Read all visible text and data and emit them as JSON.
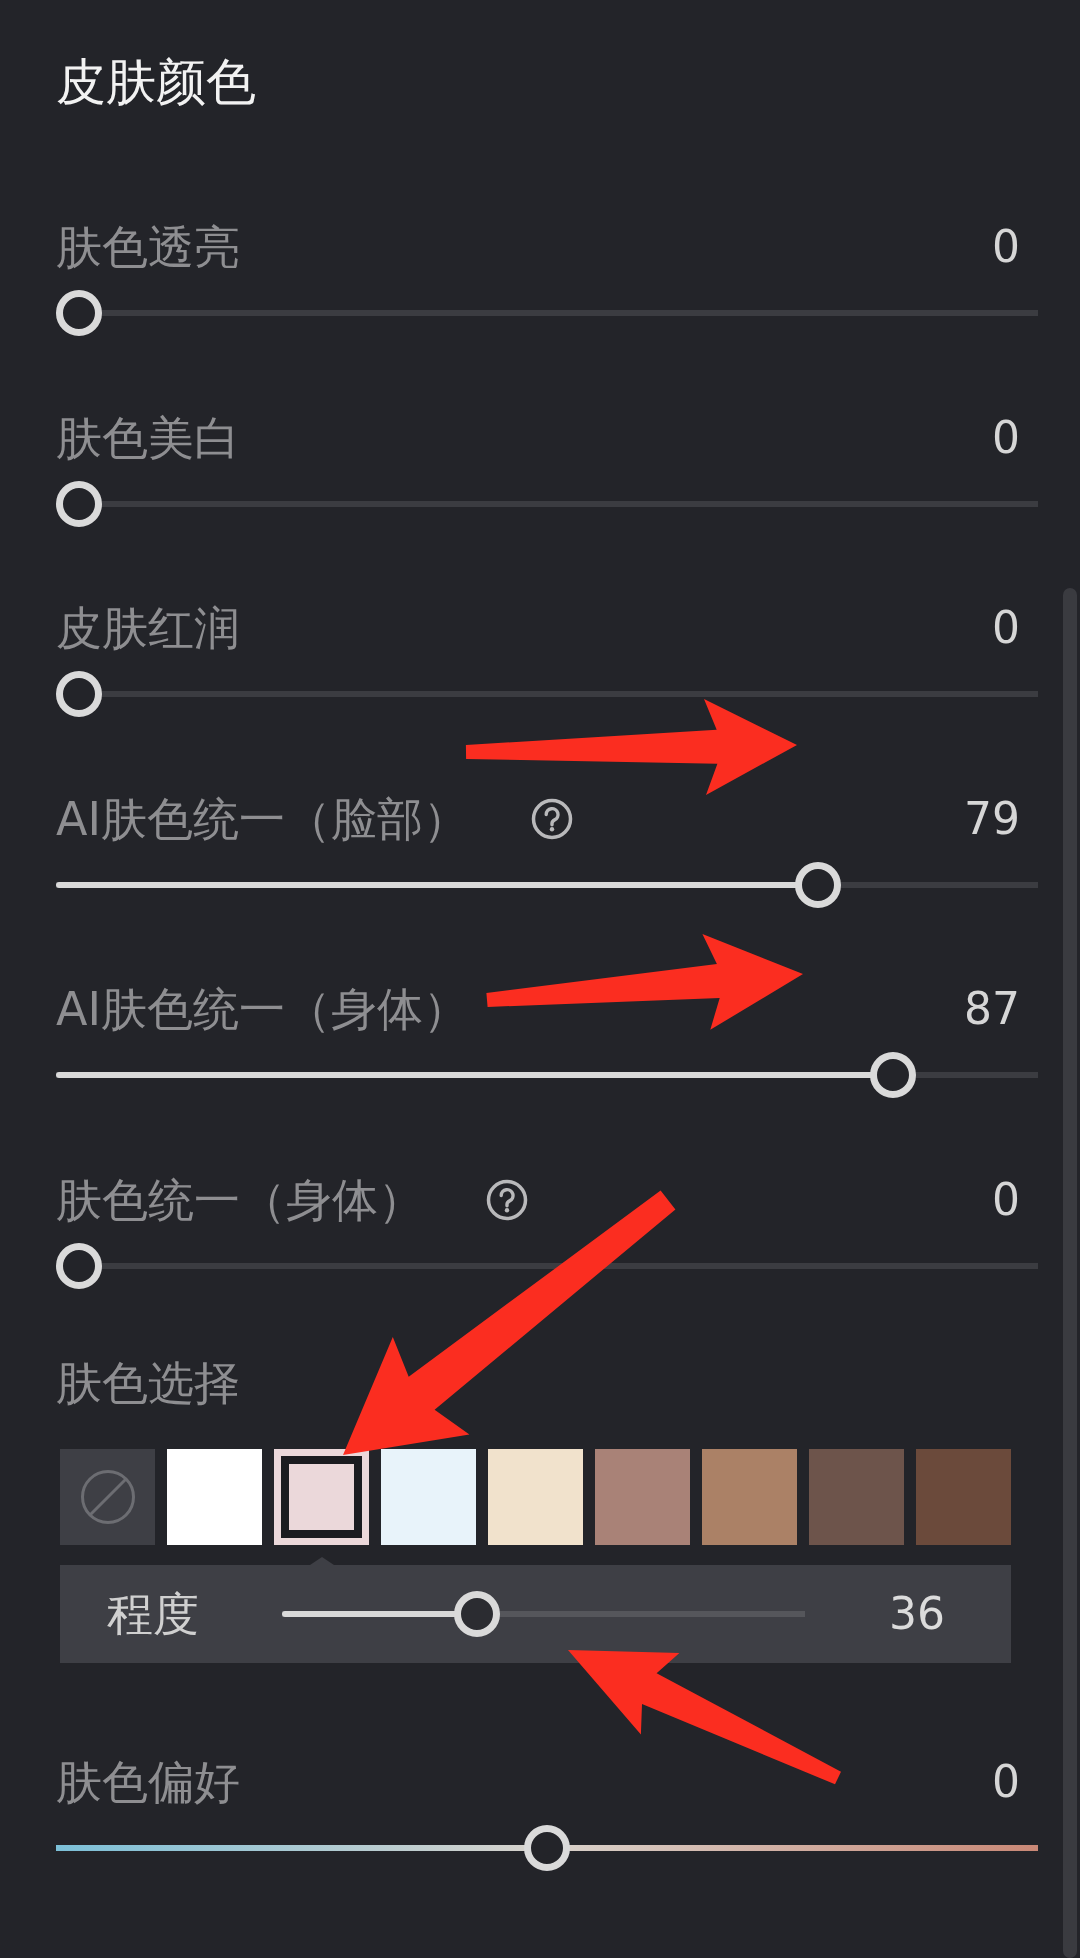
{
  "panel": {
    "title": "皮肤颜色"
  },
  "sliders": [
    {
      "label": "肤色透亮",
      "help": false,
      "reading": "0",
      "level": 0
    },
    {
      "label": "肤色美白",
      "help": false,
      "reading": "0",
      "level": 0
    },
    {
      "label": "皮肤红润",
      "help": false,
      "reading": "0",
      "level": 0
    },
    {
      "label": "AI肤色统一（脸部）",
      "help": true,
      "reading": "79",
      "level": 0.79
    },
    {
      "label": "AI肤色统一（身体）",
      "help": false,
      "reading": "87",
      "level": 0.87
    },
    {
      "label": "肤色统一（身体）",
      "help": true,
      "reading": "0",
      "level": 0
    }
  ],
  "skin_color_picker": {
    "label": "肤色选择",
    "swatches": [
      {
        "kind": "none",
        "selected": false
      },
      {
        "kind": "color",
        "color": "#ffffff",
        "selected": false
      },
      {
        "kind": "color",
        "color": "#ebd8da",
        "selected": true
      },
      {
        "kind": "color",
        "color": "#e8f3fa",
        "selected": false
      },
      {
        "kind": "color",
        "color": "#f1e2cc",
        "selected": false
      },
      {
        "kind": "color",
        "color": "#a98277",
        "selected": false
      },
      {
        "kind": "color",
        "color": "#ab8166",
        "selected": false
      },
      {
        "kind": "color",
        "color": "#6d544b",
        "selected": false
      },
      {
        "kind": "color",
        "color": "#6b4a3b",
        "selected": false
      }
    ],
    "strength": {
      "label": "程度",
      "reading": "36",
      "level": 0.36
    }
  },
  "preference_slider": {
    "label": "肤色偏好",
    "reading": "0",
    "level": 0.5
  }
}
